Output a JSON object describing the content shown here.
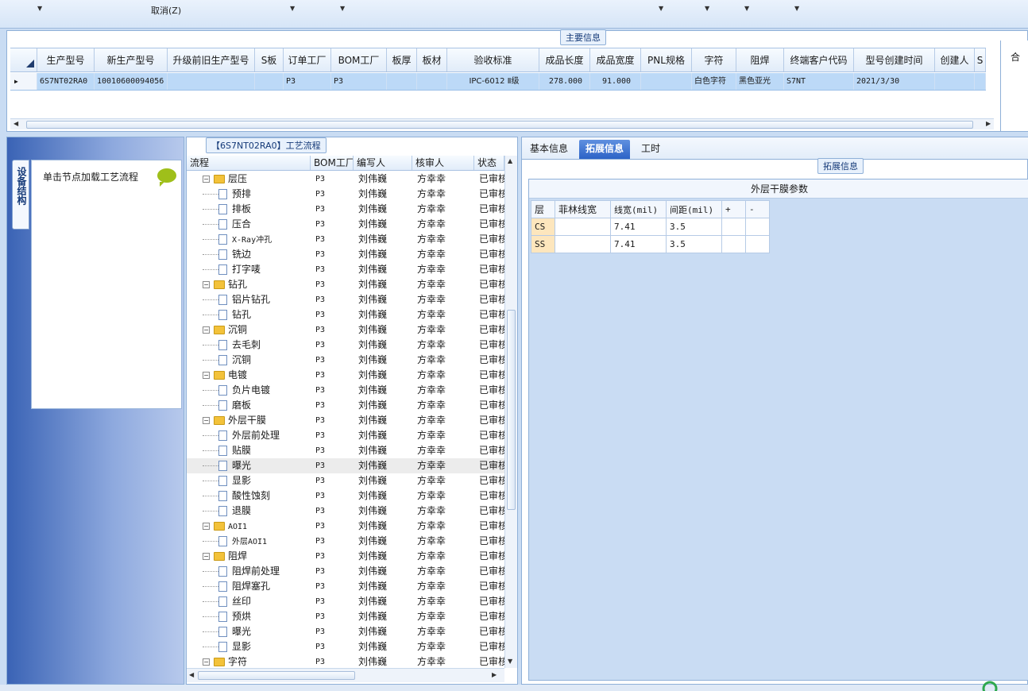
{
  "toolbar": {
    "cancel_label": "取消(Z)"
  },
  "main_info": {
    "title": "主要信息",
    "columns": [
      "生产型号",
      "新生产型号",
      "升级前旧生产型号",
      "S板",
      "订单工厂",
      "BOM工厂",
      "板厚",
      "板材",
      "验收标准",
      "成品长度",
      "成品宽度",
      "PNL规格",
      "字符",
      "阻焊",
      "终端客户代码",
      "型号创建时间",
      "创建人",
      "S"
    ],
    "row": [
      "6S7NT02RA0",
      "10010600094056",
      "",
      "",
      "P3",
      "P3",
      "",
      "",
      "IPC-6012 Ⅱ级",
      "278.000",
      "91.000",
      "",
      "白色字符",
      "黑色亚光",
      "S7NT",
      "2021/3/30",
      "",
      ""
    ],
    "side_label": "合"
  },
  "left_dock": {
    "vertical_tab": "设备结构",
    "hint": "单击节点加载工艺流程"
  },
  "process": {
    "title": "【6S7NT02RA0】工艺流程",
    "columns": [
      "流程",
      "BOM工厂",
      "编写人",
      "核审人",
      "状态"
    ],
    "rows": [
      {
        "level": 0,
        "name": "层压",
        "bom": "P3",
        "writer": "刘伟巍",
        "reviewer": "方幸幸",
        "status": "已审核"
      },
      {
        "level": 1,
        "name": "预排",
        "bom": "P3",
        "writer": "刘伟巍",
        "reviewer": "方幸幸",
        "status": "已审核"
      },
      {
        "level": 1,
        "name": "排板",
        "bom": "P3",
        "writer": "刘伟巍",
        "reviewer": "方幸幸",
        "status": "已审核"
      },
      {
        "level": 1,
        "name": "压合",
        "bom": "P3",
        "writer": "刘伟巍",
        "reviewer": "方幸幸",
        "status": "已审核"
      },
      {
        "level": 1,
        "name": "X-Ray冲孔",
        "bom": "P3",
        "writer": "刘伟巍",
        "reviewer": "方幸幸",
        "status": "已审核"
      },
      {
        "level": 1,
        "name": "铣边",
        "bom": "P3",
        "writer": "刘伟巍",
        "reviewer": "方幸幸",
        "status": "已审核"
      },
      {
        "level": 1,
        "name": "打字唛",
        "bom": "P3",
        "writer": "刘伟巍",
        "reviewer": "方幸幸",
        "status": "已审核"
      },
      {
        "level": 0,
        "name": "钻孔",
        "bom": "P3",
        "writer": "刘伟巍",
        "reviewer": "方幸幸",
        "status": "已审核"
      },
      {
        "level": 1,
        "name": "铝片钻孔",
        "bom": "P3",
        "writer": "刘伟巍",
        "reviewer": "方幸幸",
        "status": "已审核"
      },
      {
        "level": 1,
        "name": "钻孔",
        "bom": "P3",
        "writer": "刘伟巍",
        "reviewer": "方幸幸",
        "status": "已审核"
      },
      {
        "level": 0,
        "name": "沉铜",
        "bom": "P3",
        "writer": "刘伟巍",
        "reviewer": "方幸幸",
        "status": "已审核"
      },
      {
        "level": 1,
        "name": "去毛刺",
        "bom": "P3",
        "writer": "刘伟巍",
        "reviewer": "方幸幸",
        "status": "已审核"
      },
      {
        "level": 1,
        "name": "沉铜",
        "bom": "P3",
        "writer": "刘伟巍",
        "reviewer": "方幸幸",
        "status": "已审核"
      },
      {
        "level": 0,
        "name": "电镀",
        "bom": "P3",
        "writer": "刘伟巍",
        "reviewer": "方幸幸",
        "status": "已审核"
      },
      {
        "level": 1,
        "name": "负片电镀",
        "bom": "P3",
        "writer": "刘伟巍",
        "reviewer": "方幸幸",
        "status": "已审核"
      },
      {
        "level": 1,
        "name": "磨板",
        "bom": "P3",
        "writer": "刘伟巍",
        "reviewer": "方幸幸",
        "status": "已审核"
      },
      {
        "level": 0,
        "name": "外层干膜",
        "bom": "P3",
        "writer": "刘伟巍",
        "reviewer": "方幸幸",
        "status": "已审核"
      },
      {
        "level": 1,
        "name": "外层前处理",
        "bom": "P3",
        "writer": "刘伟巍",
        "reviewer": "方幸幸",
        "status": "已审核"
      },
      {
        "level": 1,
        "name": "贴膜",
        "bom": "P3",
        "writer": "刘伟巍",
        "reviewer": "方幸幸",
        "status": "已审核"
      },
      {
        "level": 1,
        "name": "曝光",
        "bom": "P3",
        "writer": "刘伟巍",
        "reviewer": "方幸幸",
        "status": "已审核",
        "selected": true
      },
      {
        "level": 1,
        "name": "显影",
        "bom": "P3",
        "writer": "刘伟巍",
        "reviewer": "方幸幸",
        "status": "已审核"
      },
      {
        "level": 1,
        "name": "酸性蚀刻",
        "bom": "P3",
        "writer": "刘伟巍",
        "reviewer": "方幸幸",
        "status": "已审核"
      },
      {
        "level": 1,
        "name": "退膜",
        "bom": "P3",
        "writer": "刘伟巍",
        "reviewer": "方幸幸",
        "status": "已审核"
      },
      {
        "level": 0,
        "name": "AOI1",
        "bom": "P3",
        "writer": "刘伟巍",
        "reviewer": "方幸幸",
        "status": "已审核"
      },
      {
        "level": 1,
        "name": "外层AOI1",
        "bom": "P3",
        "writer": "刘伟巍",
        "reviewer": "方幸幸",
        "status": "已审核"
      },
      {
        "level": 0,
        "name": "阻焊",
        "bom": "P3",
        "writer": "刘伟巍",
        "reviewer": "方幸幸",
        "status": "已审核"
      },
      {
        "level": 1,
        "name": "阻焊前处理",
        "bom": "P3",
        "writer": "刘伟巍",
        "reviewer": "方幸幸",
        "status": "已审核"
      },
      {
        "level": 1,
        "name": "阻焊塞孔",
        "bom": "P3",
        "writer": "刘伟巍",
        "reviewer": "方幸幸",
        "status": "已审核"
      },
      {
        "level": 1,
        "name": "丝印",
        "bom": "P3",
        "writer": "刘伟巍",
        "reviewer": "方幸幸",
        "status": "已审核"
      },
      {
        "level": 1,
        "name": "预烘",
        "bom": "P3",
        "writer": "刘伟巍",
        "reviewer": "方幸幸",
        "status": "已审核"
      },
      {
        "level": 1,
        "name": "曝光",
        "bom": "P3",
        "writer": "刘伟巍",
        "reviewer": "方幸幸",
        "status": "已审核"
      },
      {
        "level": 1,
        "name": "显影",
        "bom": "P3",
        "writer": "刘伟巍",
        "reviewer": "方幸幸",
        "status": "已审核"
      },
      {
        "level": 0,
        "name": "字符",
        "bom": "P3",
        "writer": "刘伟巍",
        "reviewer": "方幸幸",
        "status": "已审核"
      }
    ]
  },
  "right": {
    "tabs": [
      "基本信息",
      "拓展信息",
      "工时"
    ],
    "active_tab": 1,
    "ext_title": "拓展信息",
    "film_title": "外层干膜参数",
    "film_columns": [
      "层",
      "菲林线宽",
      "线宽(mil)",
      "间距(mil)",
      "+",
      "-"
    ],
    "film_rows": [
      [
        "CS",
        "",
        "7.41",
        "3.5",
        "",
        ""
      ],
      [
        "SS",
        "",
        "7.41",
        "3.5",
        "",
        ""
      ]
    ]
  },
  "colors": {
    "selected_row": "#bcd9f7",
    "active_tab": "#2c63c6",
    "layer_cell": "#fde6bd"
  }
}
